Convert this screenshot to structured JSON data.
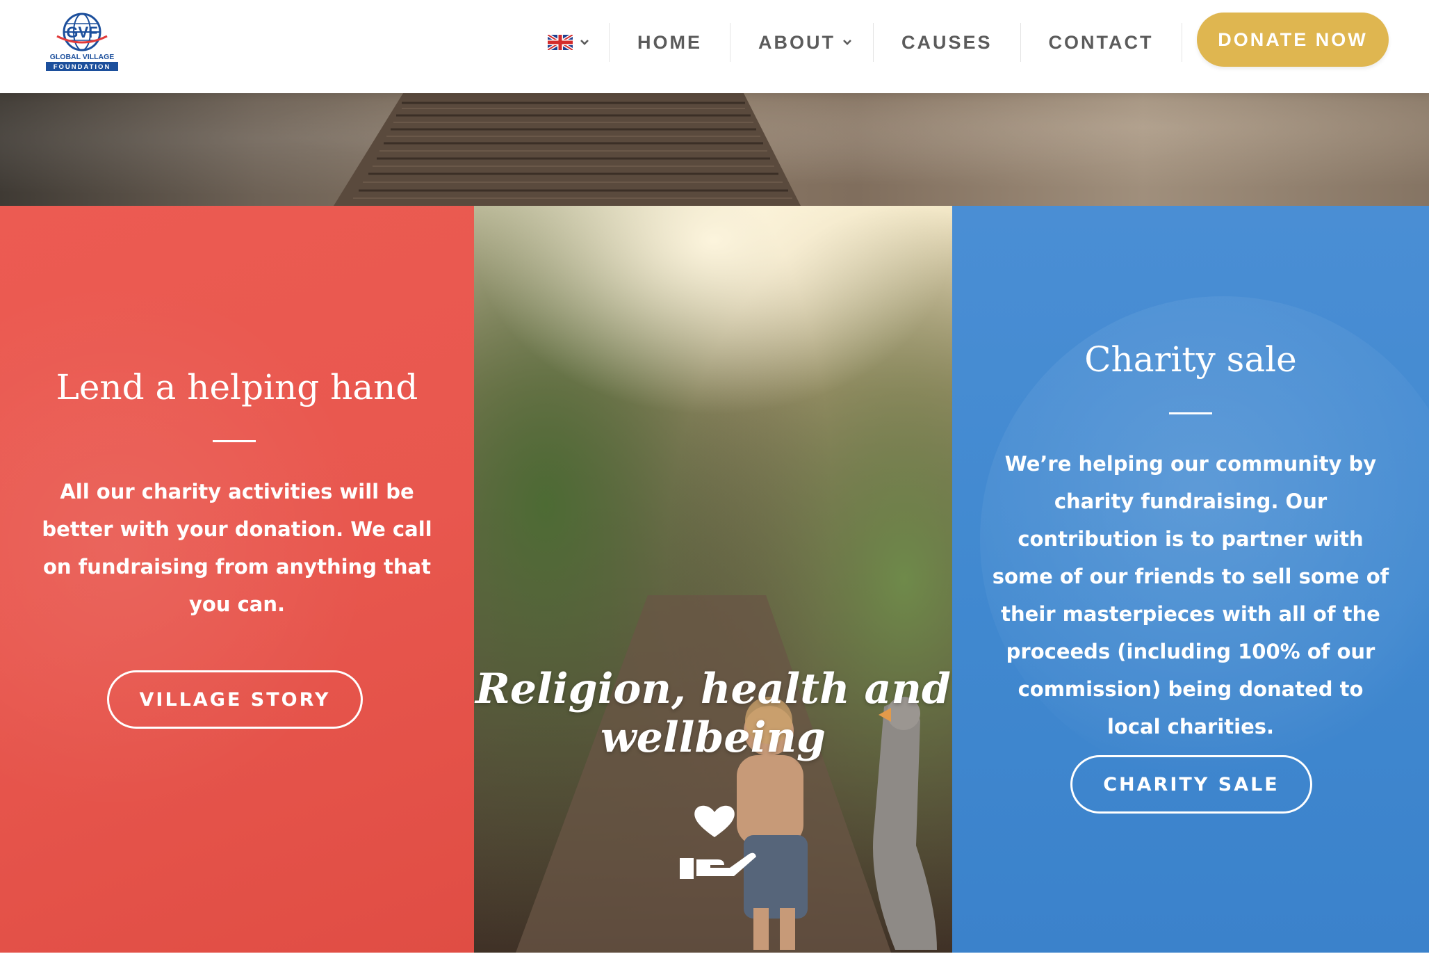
{
  "header": {
    "logo": {
      "text_top": "GLOBAL VILLAGE",
      "text_bottom": "FOUNDATION",
      "mark": "GVF"
    },
    "language": {
      "icon": "uk-flag-icon"
    },
    "nav": [
      {
        "label": "HOME"
      },
      {
        "label": "ABOUT",
        "has_dropdown": true
      },
      {
        "label": "CAUSES"
      },
      {
        "label": "CONTACT"
      }
    ],
    "donate_label": "DONATE NOW"
  },
  "panels": {
    "left": {
      "title": "Lend a helping hand",
      "body": "All our charity activities will be better with your donation. We call on fundraising from anything that you can.",
      "button_label": "VILLAGE STORY"
    },
    "middle": {
      "title_line1": "Religion, health and",
      "title_line2": "wellbeing",
      "icon": "heart-hand-icon"
    },
    "right": {
      "title": "Charity sale",
      "body": "We’re helping our community by charity fundraising. Our contribution is to partner with some of our friends to sell some of their masterpieces with all of the proceeds (including 100% of our commission) being donated to local charities.",
      "button_label": "CHARITY SALE"
    }
  },
  "colors": {
    "red_panel": "#e8574e",
    "blue_panel": "#4189d0",
    "donate": "#dfb650",
    "nav_text": "#5b5b5b",
    "logo_blue": "#1c4f9c"
  }
}
